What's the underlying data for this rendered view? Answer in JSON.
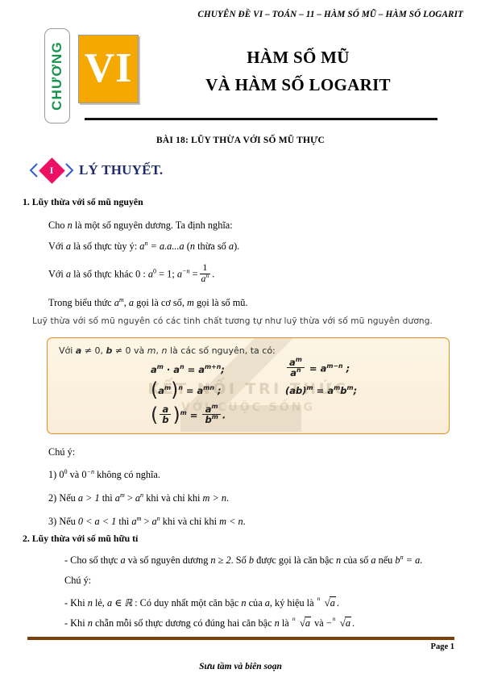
{
  "header": {
    "running_head": "CHUYÊN ĐỀ VI – TOÁN – 11  – HÀM SỐ MŨ – HÀM SỐ LOGARIT"
  },
  "chapter_badge": {
    "word": "CHƯƠNG",
    "number": "VI",
    "word_color": "#17944c",
    "box_color": "#f5a800"
  },
  "title": {
    "line1": "HÀM SỐ MŨ",
    "line2": "VÀ HÀM SỐ LOGARIT"
  },
  "lesson": {
    "title": "BÀI 18: LŨY THỪA VỚI SỐ MŨ THỰC"
  },
  "section": {
    "marker": "I",
    "label": "LÝ THUYẾT.",
    "marker_color": "#ec1164",
    "label_color": "#1f2a6b",
    "chevron_color": "#2f5fd0"
  },
  "part1": {
    "heading": "1. Lũy thừa với số mũ nguyên",
    "p_intro_a": "Cho",
    "p_intro_n": "n",
    "p_intro_b": "là một số nguyên dương. Ta định nghĩa:",
    "p_real_a": "Với",
    "p_real_var": "a",
    "p_real_b": "là số thực tùy ý:",
    "p_real_expr": "a",
    "p_real_expr_sup": "n",
    "p_real_eq": "= a.a...a",
    "p_real_tail_open": "(",
    "p_real_tail_n": "n",
    "p_real_tail_mid": "thừa số",
    "p_real_tail_a": "a",
    "p_real_tail_close": ").",
    "p_zero_a": "Với",
    "p_zero_var": "a",
    "p_zero_b": "là số thực khác",
    "p_zero_num": "0 :",
    "p_zero_expr1_base": "a",
    "p_zero_expr1_sup": "0",
    "p_zero_expr1_eq": "= 1;",
    "p_zero_expr2_base": "a",
    "p_zero_expr2_sup": "−n",
    "p_zero_expr2_eq": "=",
    "p_zero_frac_num": "1",
    "p_zero_frac_den_base": "a",
    "p_zero_frac_den_sup": "n",
    "p_zero_period": ".",
    "p_terms_a": "Trong biểu thức",
    "p_terms_expr_base": "a",
    "p_terms_expr_sup": "m",
    "p_terms_b": ",",
    "p_terms_var_a": "a",
    "p_terms_c": "gọi là cơ số,",
    "p_terms_var_m": "m",
    "p_terms_d": "gọi là số mũ."
  },
  "scan_note": "Luỹ thừa với số mũ nguyên có các tinh chất tương tự như luỹ thừa với số mũ nguyên dương.",
  "formula_box": {
    "lead_pre": "Với ",
    "lead_a": "a",
    "lead_ne1": " ≠ 0, ",
    "lead_b": "b",
    "lead_ne2": " ≠ 0 và ",
    "lead_m": "m",
    "lead_comma": ", ",
    "lead_n": "n",
    "lead_tail": " là các số nguyên, ta có:",
    "f1": "a^m · a^n = a^(m+n);",
    "f2": "a^m / a^n = a^(m−n);",
    "f3": "(a^m)^n = a^(mn);",
    "f4": "(ab)^m = a^m b^m;",
    "f5": "(a/b)^m = a^m / b^m.",
    "watermark_line1": "KẾT NỐI TRI THỨC",
    "watermark_line2": "VỚI CUỘC SỐNG",
    "border_color": "#e28b22",
    "fill_color": "#fdf6e6"
  },
  "notes1": {
    "label": "Chú ý:",
    "n1_pre": "1)",
    "n1_a_base": "0",
    "n1_a_sup": "0",
    "n1_mid": "và",
    "n1_b_base": "0",
    "n1_b_sup": "−n",
    "n1_tail": "không có nghĩa.",
    "n2_pre": "2) Nếu",
    "n2_cond": "a > 1",
    "n2_mid": "thì",
    "n2_l_base": "a",
    "n2_l_sup": "m",
    "n2_rel": ">",
    "n2_r_base": "a",
    "n2_r_sup": "n",
    "n2_tail": "khi và chỉ khi",
    "n2_end": "m > n",
    "n2_dot": ".",
    "n3_pre": "3) Nếu",
    "n3_cond": "0 < a < 1",
    "n3_mid": "thì",
    "n3_l_base": "a",
    "n3_l_sup": "m",
    "n3_rel": ">",
    "n3_r_base": "a",
    "n3_r_sup": "n",
    "n3_tail": "khi và chỉ khi",
    "n3_end": "m < n",
    "n3_dot": "."
  },
  "part2": {
    "heading": "2. Lũy thừa với số mũ hữu tỉ",
    "b1_pre": "- Cho số thực",
    "b1_a": "a",
    "b1_mid": "và số nguyên dương",
    "b1_cond": "n ≥ 2",
    "b1_dot": ". Số",
    "b1_b": "b",
    "b1_mid2": "được gọi là căn bậc",
    "b1_n": "n",
    "b1_of": "của số",
    "b1_a2": "a",
    "b1_if": "nếu",
    "b1_eq_base": "b",
    "b1_eq_sup": "n",
    "b1_eq_tail": "= a",
    "b1_end": ".",
    "label_note": "Chú ý:",
    "b2_pre": "- Khi",
    "b2_n": "n",
    "b2_le": "lẻ,",
    "b2_member": "a ∈ ℝ",
    "b2_colon": ": Có duy nhất một căn bậc",
    "b2_n2": "n",
    "b2_of": "của",
    "b2_a": "a",
    "b2_notation": ", ký hiệu là",
    "b2_rad_idx": "n",
    "b2_rad_body": "a",
    "b2_dot": ".",
    "b3_pre": "- Khi",
    "b3_n": "n",
    "b3_mid": "chẵn mỗi số thực dương có đúng hai căn bậc",
    "b3_n2": "n",
    "b3_is": "là",
    "b3_rad1_idx": "n",
    "b3_rad1_body": "a",
    "b3_and": "và",
    "b3_minus": "−",
    "b3_rad2_idx": "n",
    "b3_rad2_body": "a",
    "b3_dot": "."
  },
  "footer": {
    "page_label": "Page 1",
    "credit": "Sưu tầm và biên soạn",
    "rule_color": "#7b3f0a"
  }
}
